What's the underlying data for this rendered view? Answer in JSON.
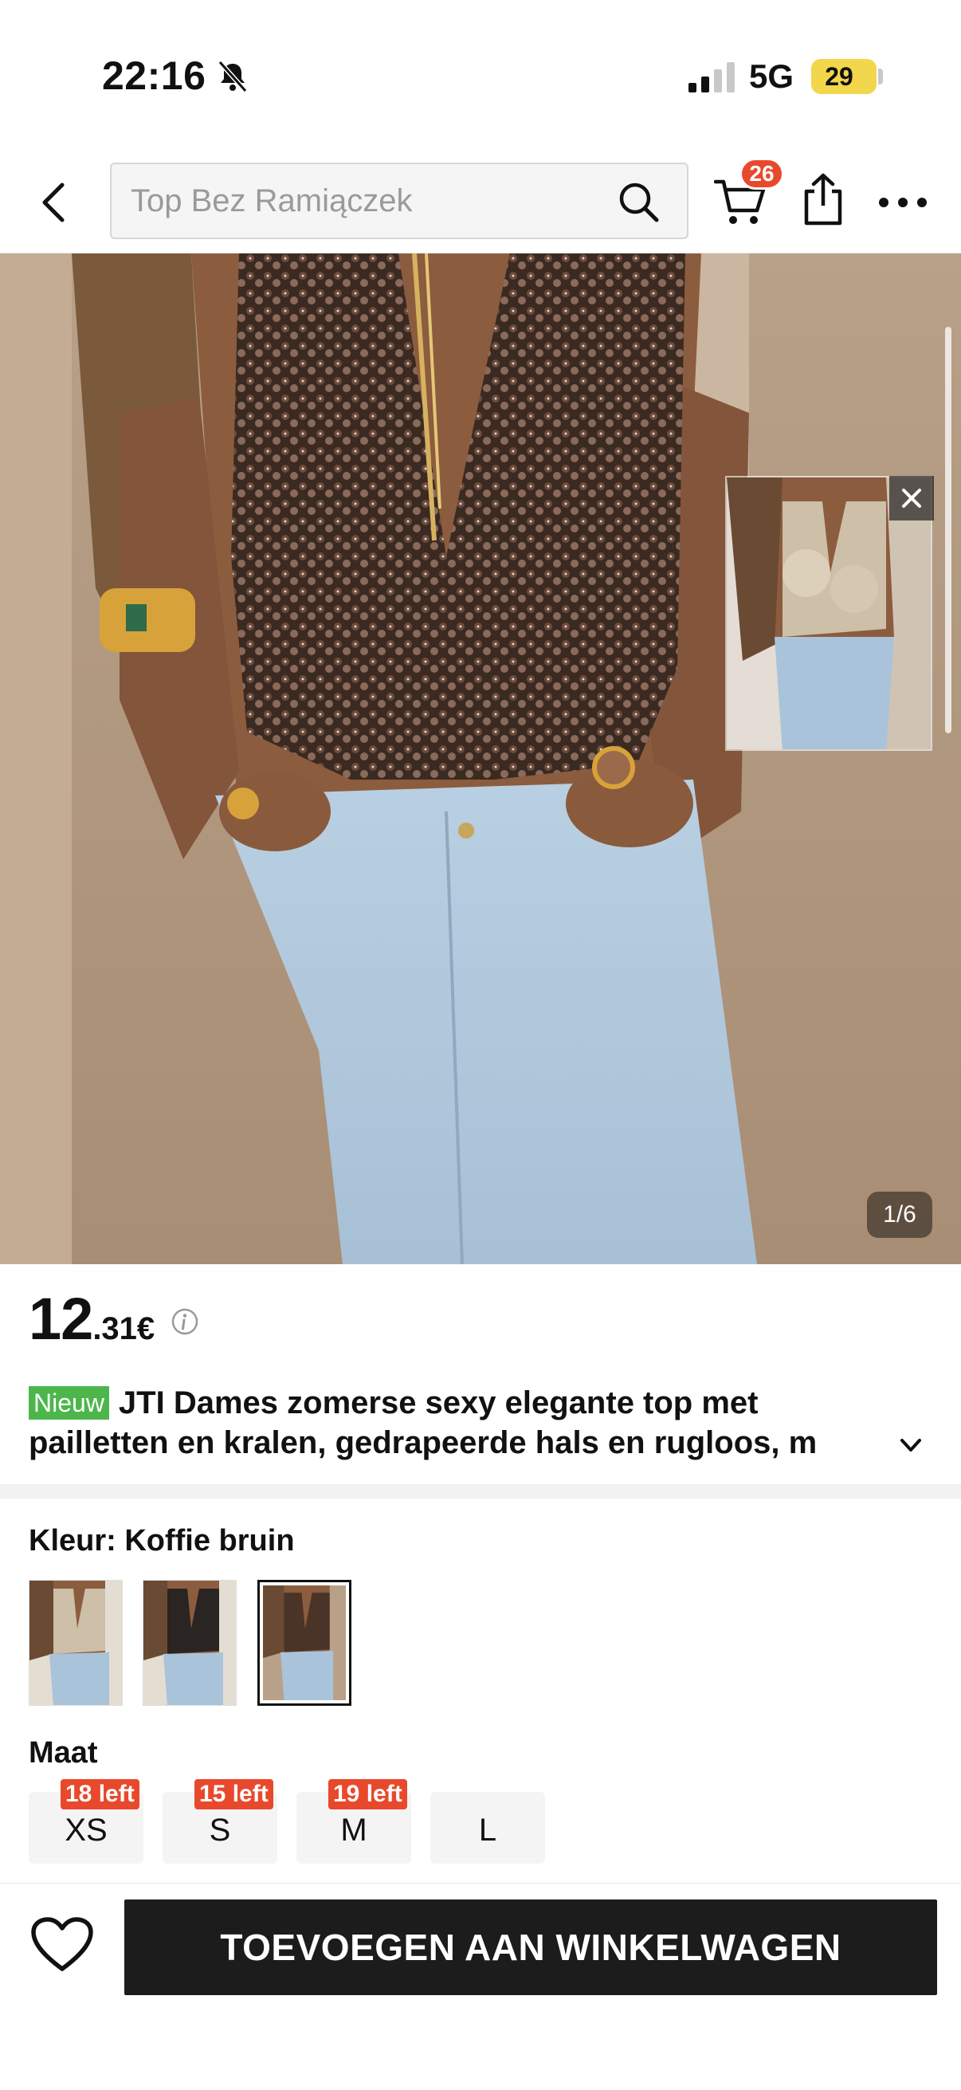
{
  "status_bar": {
    "time": "22:16",
    "network": "5G",
    "battery": "29",
    "icons": [
      "bell-slash-icon",
      "signal-icon",
      "battery-icon"
    ]
  },
  "nav": {
    "search_placeholder": "Top Bez Ramiączek",
    "cart_count": "26",
    "icons": [
      "back-chevron-icon",
      "search-icon",
      "cart-icon",
      "share-icon",
      "more-icon"
    ]
  },
  "gallery": {
    "indicator": "1/6",
    "current_index": 1,
    "total": 6
  },
  "product": {
    "price_main": "12",
    "price_decimal": ".31€",
    "badge": "Nieuw",
    "title_line1": "JTI Dames zomerse sexy elegante top met",
    "title_line2": "pailletten en kralen, gedrapeerde hals en rugloos, m"
  },
  "colour": {
    "label": "Kleur: Koffie bruin",
    "selected_index": 2,
    "swatches": [
      "gold-sequin",
      "black-sequin",
      "coffee-brown-sequin"
    ]
  },
  "size": {
    "label": "Maat",
    "options": [
      {
        "size": "XS",
        "stock": "18 left"
      },
      {
        "size": "S",
        "stock": "15 left"
      },
      {
        "size": "M",
        "stock": "19 left"
      },
      {
        "size": "L",
        "stock": ""
      }
    ]
  },
  "actions": {
    "add_to_cart": "TOEVOEGEN AAN WINKELWAGEN"
  },
  "colors": {
    "badge_red": "#e8492c",
    "new_green": "#4cb64c",
    "button_dark": "#1c1c1c",
    "battery_yellow": "#f2d64b"
  }
}
